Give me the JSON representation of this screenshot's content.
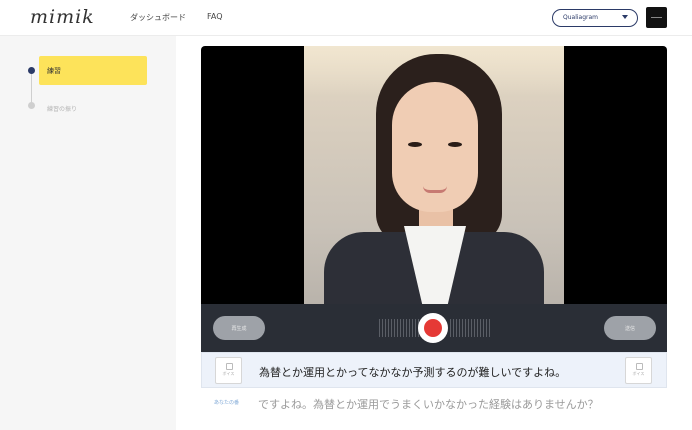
{
  "header": {
    "logo": "mimik",
    "nav": [
      "ダッシュボード",
      "FAQ"
    ],
    "select_value": "Qualiagram",
    "menu_icon": "hamburger-icon"
  },
  "sidebar": {
    "steps": [
      {
        "label": "練習",
        "active": true
      },
      {
        "label": "練習の振り",
        "active": false
      }
    ]
  },
  "controls": {
    "left_button": "再生成",
    "right_button": "送信",
    "record_icon": "record-icon"
  },
  "subtitle": {
    "text": "為替とか運用とかってなかなか予測するのが難しいですよね。",
    "left_icon_label": "ボイス",
    "right_icon_label": "ボイス"
  },
  "reply": {
    "label": "あなたの番",
    "text": "ですよね。為替とか運用でうまくいかなかった経験はありませんか？"
  },
  "colors": {
    "accent_yellow": "#fde35a",
    "navy": "#2b3a67",
    "record_red": "#e53935"
  }
}
